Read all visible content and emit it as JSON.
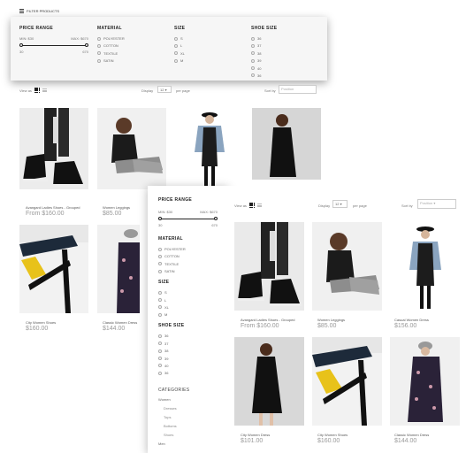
{
  "top_bar": {
    "label": "FILTER PRODUCTS"
  },
  "filter_panel": {
    "price": {
      "title": "PRICE RANGE",
      "min": "MIN: $30",
      "max": "MAX: $670",
      "low": "30",
      "high": "670"
    },
    "material": {
      "title": "MATERIAL",
      "options": [
        "POLYESTER",
        "COTTON",
        "TEXTILE",
        "SATIN"
      ]
    },
    "size": {
      "title": "SIZE",
      "options": [
        "S",
        "L",
        "XL",
        "M"
      ]
    },
    "shoe_size": {
      "title": "SHOE SIZE",
      "options": [
        "36",
        "37",
        "38",
        "39",
        "40",
        "36"
      ]
    }
  },
  "toolbar": {
    "view_as": "View as",
    "display": "Display",
    "display_value": "12",
    "per_page": "per page",
    "sort_by": "Sort by",
    "sort_value": "Position"
  },
  "back_products": [
    {
      "name": "Avangard Ladies Shoes - Grouped",
      "price": "From $160.00"
    },
    {
      "name": "Women Leggings",
      "price": "$85.00"
    },
    {
      "name": "",
      "price": ""
    },
    {
      "name": "",
      "price": ""
    },
    {
      "name": "City Women Shoes",
      "price": "$160.00"
    },
    {
      "name": "Classic Women Dress",
      "price": "$144.00"
    }
  ],
  "sidebar": {
    "price": {
      "title": "PRICE RANGE",
      "min": "MIN: $30",
      "max": "MAX: $670",
      "low": "30",
      "high": "670"
    },
    "material": {
      "title": "MATERIAL",
      "options": [
        "POLYESTER",
        "COTTON",
        "TEXTILE",
        "SATIN"
      ]
    },
    "size": {
      "title": "SIZE",
      "options": [
        "S",
        "L",
        "XL",
        "M"
      ]
    },
    "shoe_size": {
      "title": "SHOE SIZE",
      "options": [
        "36",
        "37",
        "38",
        "39",
        "40",
        "36"
      ]
    },
    "categories": {
      "title": "CATEGORIES",
      "items": [
        "Women",
        "Dresses",
        "Tops",
        "Bottoms",
        "Shoes",
        "Men"
      ]
    }
  },
  "front_products": [
    {
      "name": "Avangard Ladies Shoes - Grouped",
      "price": "From $160.00"
    },
    {
      "name": "Women Leggings",
      "price": "$85.00"
    },
    {
      "name": "Casual Women Dress",
      "price": "$156.00"
    },
    {
      "name": "City Women Dress",
      "price": "$101.00"
    },
    {
      "name": "City Women Shoes",
      "price": "$160.00"
    },
    {
      "name": "Classic Women Dress",
      "price": "$144.00"
    }
  ]
}
